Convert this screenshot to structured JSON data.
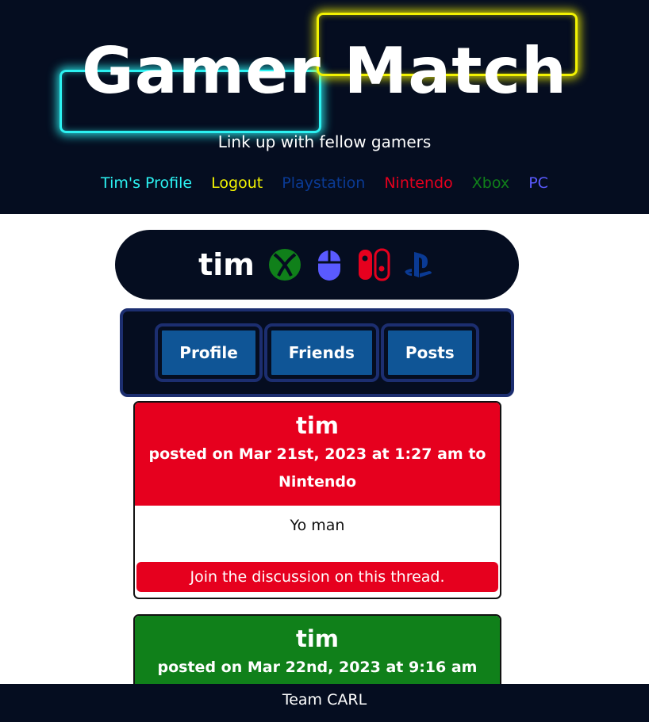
{
  "site": {
    "title": "Gamer Match",
    "tagline": "Link up with fellow gamers"
  },
  "nav": {
    "items": [
      {
        "label": "Tim's Profile",
        "color": "#2cf2f2"
      },
      {
        "label": "Logout",
        "color": "#f2f202"
      },
      {
        "label": "Playstation",
        "color": "#0a3a94"
      },
      {
        "label": "Nintendo",
        "color": "#e6001e"
      },
      {
        "label": "Xbox",
        "color": "#10801a"
      },
      {
        "label": "PC",
        "color": "#5a5aff"
      }
    ]
  },
  "profile": {
    "username": "tim",
    "platform_icons": [
      "xbox-icon",
      "mouse-icon",
      "nintendo-switch-icon",
      "playstation-icon"
    ]
  },
  "tabs": {
    "items": [
      {
        "label": "Profile"
      },
      {
        "label": "Friends"
      },
      {
        "label": "Posts"
      }
    ]
  },
  "posts": [
    {
      "author": "tim",
      "meta": "posted on Mar 21st, 2023 at 1:27 am to Nintendo",
      "body": "Yo man",
      "link": "Join the discussion on this thread.",
      "color": "#e6001e"
    },
    {
      "author": "tim",
      "meta": "posted on Mar 22nd, 2023 at 9:16 am",
      "color": "#10801a"
    }
  ],
  "footer": {
    "text": "Team CARL"
  },
  "colors": {
    "dark": "#050d20",
    "cyan": "#2cf2f2",
    "yellow": "#f2f202",
    "button_blue": "#0f5596"
  }
}
